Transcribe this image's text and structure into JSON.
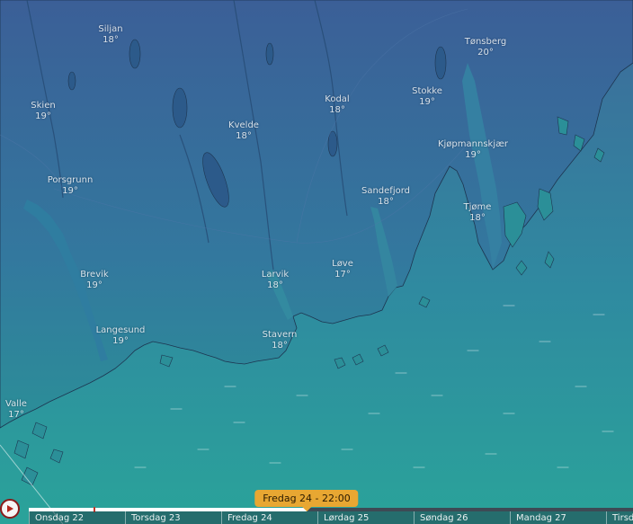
{
  "map": {
    "colors": {
      "sea_top": "#3e6a9a",
      "sea_bottom": "#2aa39a",
      "land_top": "#3b5f97",
      "land_bottom": "#2b8f98",
      "border": "#1d3550",
      "accent": "#e8a732"
    },
    "cities": [
      {
        "name": "Siljan",
        "temp": "18°"
      },
      {
        "name": "Tønsberg",
        "temp": "20°"
      },
      {
        "name": "Skien",
        "temp": "19°"
      },
      {
        "name": "Stokke",
        "temp": "19°"
      },
      {
        "name": "Kodal",
        "temp": "18°"
      },
      {
        "name": "Kvelde",
        "temp": "18°"
      },
      {
        "name": "Kjøpmannskjær",
        "temp": "19°"
      },
      {
        "name": "Porsgrunn",
        "temp": "19°"
      },
      {
        "name": "Sandefjord",
        "temp": "18°"
      },
      {
        "name": "Tjøme",
        "temp": "18°"
      },
      {
        "name": "Løve",
        "temp": "17°"
      },
      {
        "name": "Brevik",
        "temp": "19°"
      },
      {
        "name": "Larvik",
        "temp": "18°"
      },
      {
        "name": "Langesund",
        "temp": "19°"
      },
      {
        "name": "Stavern",
        "temp": "18°"
      },
      {
        "name": "Valle",
        "temp": "17°"
      }
    ]
  },
  "timeline": {
    "current_time": "Fredag 24 - 22:00",
    "progress": 0.46,
    "days": [
      "Onsdag 22",
      "Torsdag 23",
      "Fredag 24",
      "Lørdag 25",
      "Søndag 26",
      "Mandag 27",
      "Tirsdag"
    ]
  }
}
